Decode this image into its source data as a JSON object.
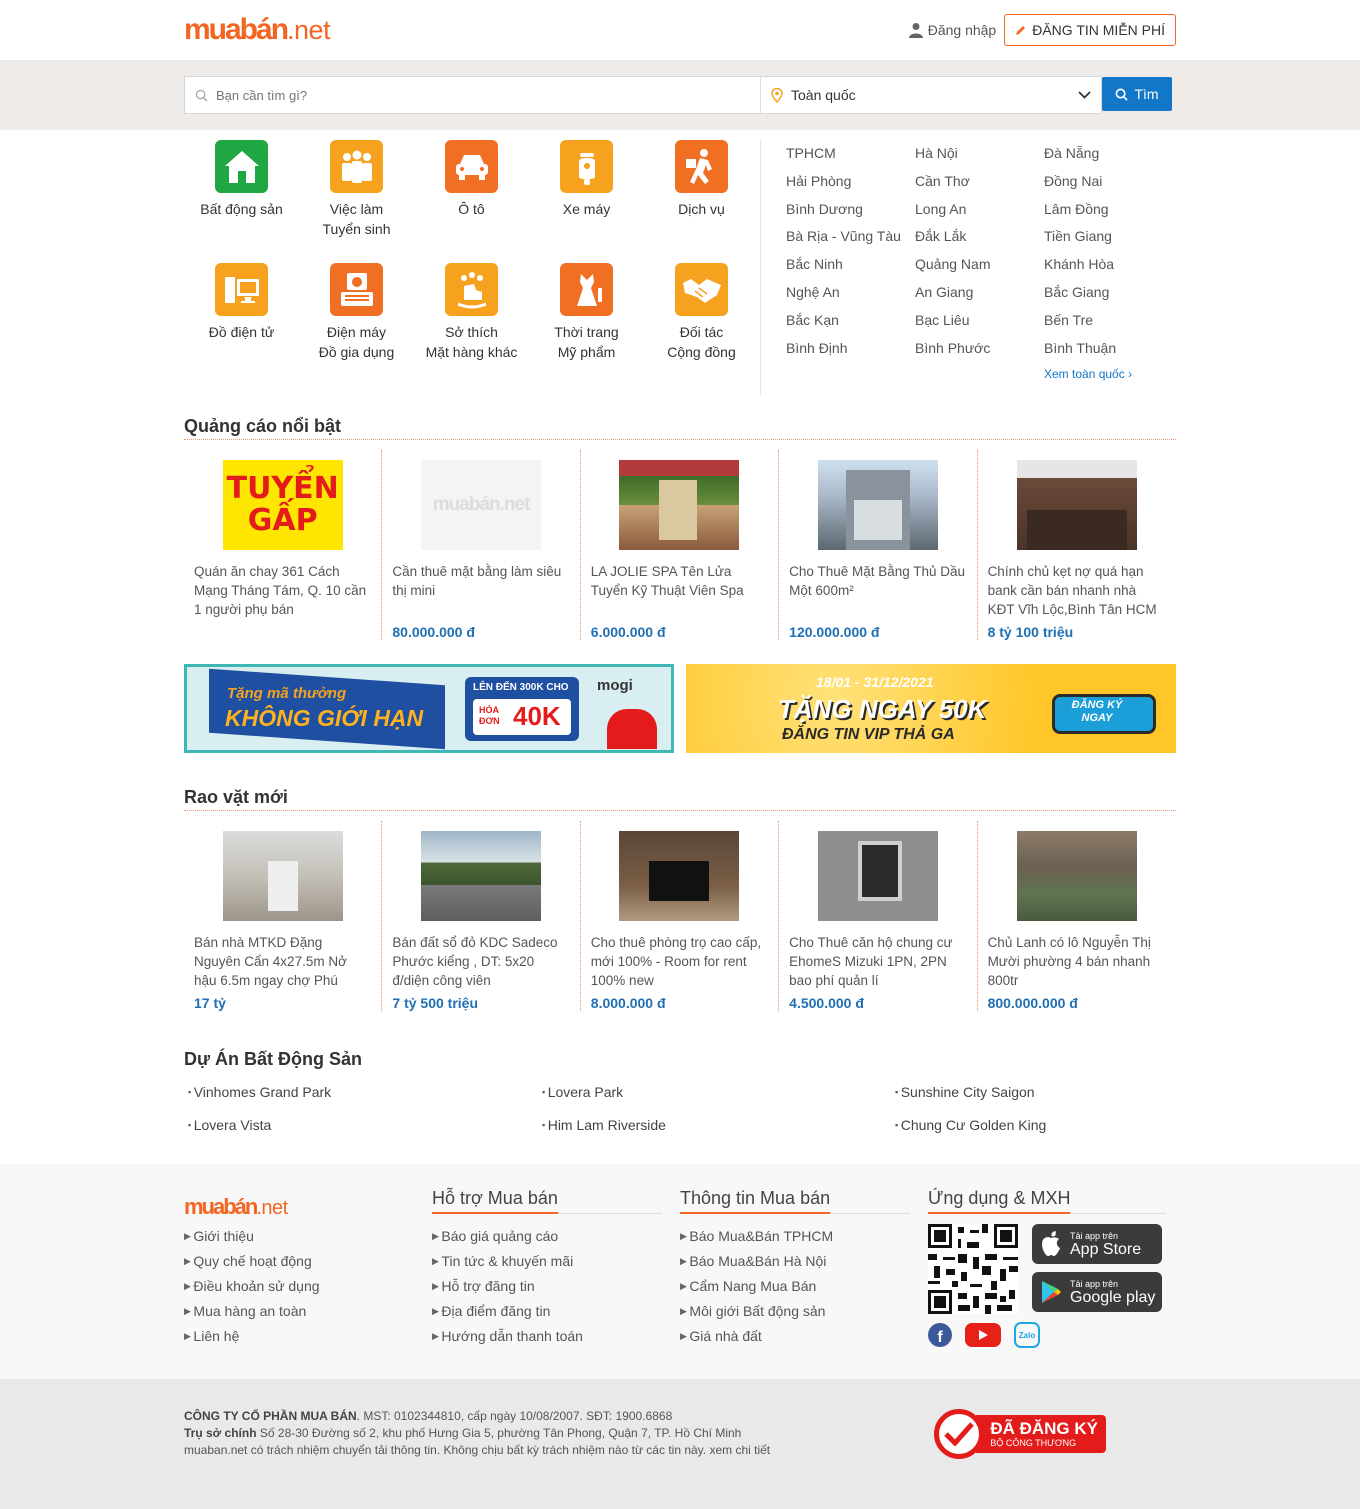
{
  "header": {
    "logo_main": "muabán",
    "logo_tld": ".net",
    "login_label": "Đăng nhập",
    "post_label": "ĐĂNG TIN MIỄN PHÍ"
  },
  "search": {
    "placeholder": "Bạn cần tìm gì?",
    "location_value": "Toàn quốc",
    "button_label": "Tìm"
  },
  "categories": [
    {
      "label1": "Bất động sản",
      "label2": "",
      "icon": "house-icon"
    },
    {
      "label1": "Việc làm",
      "label2": "Tuyển sinh",
      "icon": "people-icon"
    },
    {
      "label1": "Ô tô",
      "label2": "",
      "icon": "car-icon"
    },
    {
      "label1": "Xe máy",
      "label2": "",
      "icon": "scooter-icon"
    },
    {
      "label1": "Dịch vụ",
      "label2": "",
      "icon": "delivery-icon"
    },
    {
      "label1": "Đồ điện tử",
      "label2": "",
      "icon": "computer-icon"
    },
    {
      "label1": "Điện máy",
      "label2": "Đồ gia dụng",
      "icon": "appliance-icon"
    },
    {
      "label1": "Sở thích",
      "label2": "Mặt hàng khác",
      "icon": "toy-horse-icon"
    },
    {
      "label1": "Thời trang",
      "label2": "Mỹ phẩm",
      "icon": "dress-icon"
    },
    {
      "label1": "Đối tác",
      "label2": "Cộng đồng",
      "icon": "handshake-icon"
    }
  ],
  "cities": [
    "TPHCM",
    "Hà Nội",
    "Đà Nẵng",
    "Hải Phòng",
    "Cần Thơ",
    "Đồng Nai",
    "Bình Dương",
    "Long An",
    "Lâm Đồng",
    "Bà Rịa - Vũng Tàu",
    "Đắk Lắk",
    "Tiền Giang",
    "Bắc Ninh",
    "Quảng Nam",
    "Khánh Hòa",
    "Nghệ An",
    "An Giang",
    "Bắc Giang",
    "Bắc Kạn",
    "Bạc Liêu",
    "Bến Tre",
    "Bình Định",
    "Bình Phước",
    "Bình Thuận"
  ],
  "cities_view_all": "Xem toàn quốc",
  "featured": {
    "title": "Quảng cáo nổi bật",
    "items": [
      {
        "title": "Quán ăn chay 361 Cách Mạng Tháng Tám, Q. 10 cần 1 người phụ bán",
        "price": ""
      },
      {
        "title": "Cần thuê mặt bằng làm siêu thị mini",
        "price": "80.000.000 đ"
      },
      {
        "title": "LA JOLIE SPA Tên Lửa Tuyển Kỹ Thuật Viên Spa",
        "price": "6.000.000 đ"
      },
      {
        "title": "Cho Thuê Mặt Bằng Thủ Dầu Một 600m²",
        "price": "120.000.000 đ"
      },
      {
        "title": "Chính chủ kẹt nợ quá hạn bank cần bán nhanh nhà KĐT Vĩh Lộc,Bình Tân HCM",
        "price": "8 tỷ 100 triệu"
      }
    ],
    "thumb1_text1": "TUYỂN",
    "thumb1_text2": "GẤP",
    "thumb2_text": "muabán.net"
  },
  "banners": {
    "left_line1": "Tặng mã thưởng",
    "left_line2": "KHÔNG GIỚI HẠN",
    "left_badge_top": "LÊN ĐẾN 300K CHO",
    "left_badge_small": "HÓA ĐƠN",
    "left_badge_big": "40K",
    "left_brand": "mogi",
    "right_dates": "18/01 - 31/12/2021",
    "right_line1": "TẶNG NGAY 50K",
    "right_line2": "ĐĂNG TIN VIP THẢ GA",
    "right_button": "ĐĂNG KÝ NGAY"
  },
  "new_ads": {
    "title": "Rao vặt mới",
    "items": [
      {
        "title": "Bán nhà MTKD Đặng Nguyên Cẩn 4x27.5m Nở hậu 6.5m ngay chợ Phú",
        "price": "17 tỷ"
      },
      {
        "title": "Bán đất sổ đỏ KDC Sadeco Phước kiểng , DT: 5x20 đ/diện công viên",
        "price": "7 tỷ 500 triệu"
      },
      {
        "title": "Cho thuê phòng trọ cao cấp, mới 100% - Room for rent 100% new",
        "price": "8.000.000 đ"
      },
      {
        "title": "Cho Thuê căn hộ chung cư EhomeS Mizuki 1PN, 2PN bao phí quản lí",
        "price": "4.500.000 đ"
      },
      {
        "title": "Chủ Lanh có lô Nguyễn Thị Mười phường 4 bán nhanh 800tr",
        "price": "800.000.000 đ"
      }
    ]
  },
  "projects": {
    "title": "Dự Án Bất Động Sản",
    "items": [
      "Vinhomes Grand Park",
      "Lovera Park",
      "Sunshine City Saigon",
      "Lovera Vista",
      "Him Lam Riverside",
      "Chung Cư Golden King"
    ]
  },
  "footer": {
    "col1": [
      "Giới thiệu",
      "Quy chế hoạt động",
      "Điều khoản sử dụng",
      "Mua hàng an toàn",
      "Liên hệ"
    ],
    "col2_title": "Hỗ trợ Mua bán",
    "col2": [
      "Báo giá quảng cáo",
      "Tin tức & khuyến mãi",
      "Hỗ trợ đăng tin",
      "Địa điểm đăng tin",
      "Hướng dẫn thanh toán"
    ],
    "col3_title": "Thông tin Mua bán",
    "col3": [
      "Báo Mua&Bán TPHCM",
      "Báo Mua&Bán Hà Nội",
      "Cẩm Nang Mua Bán",
      "Môi giới Bất động sản",
      "Giá nhà đất"
    ],
    "col4_title": "Ứng dụng & MXH",
    "appstore_small": "Tải app trên",
    "appstore_big": "App Store",
    "gplay_small": "Tải app trên",
    "gplay_big": "Google play",
    "zalo": "Zalo"
  },
  "company": {
    "name": "CÔNG TY CỔ PHẦN MUA BÁN",
    "line1_rest": ". MST: 0102344810, cấp ngày 10/08/2007. SĐT: 1900.6868",
    "hq_label": "Trụ sở chính",
    "hq_rest": " Số 28-30 Đường số 2, khu phố Hưng Gia 5, phường Tân Phong, Quận 7, TP. Hồ Chí Minh",
    "line3": "muaban.net có trách nhiệm chuyển tải thông tin. Không chịu bất kỳ trách nhiệm nào từ các tin này. xem chi tiết",
    "badge_main": "ĐÃ ĐĂNG KÝ",
    "badge_sub": "BỘ CÔNG THƯƠNG"
  },
  "colors": {
    "brand_orange": "#f26522",
    "primary_blue": "#1276c9",
    "price_blue": "#1f6fb5"
  }
}
